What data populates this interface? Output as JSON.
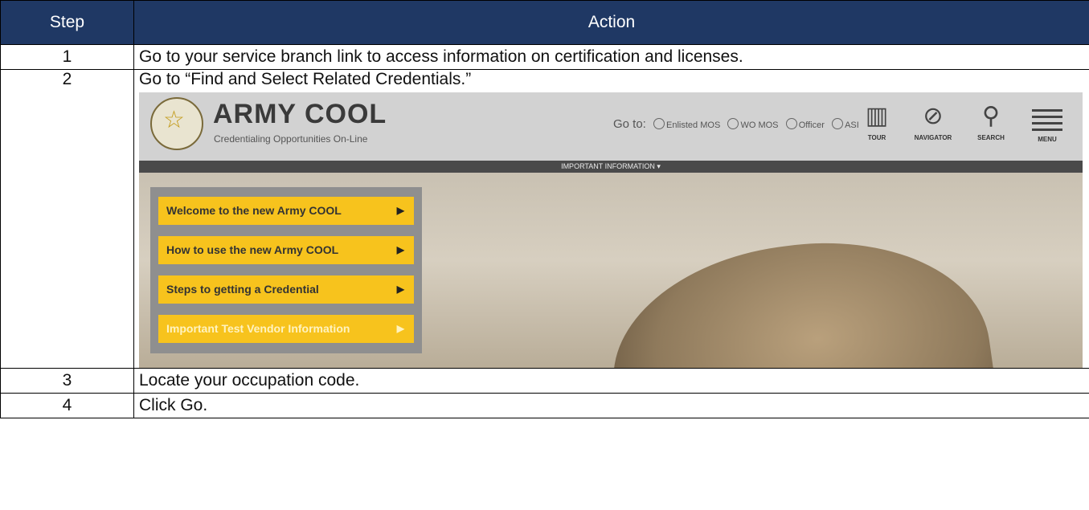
{
  "table": {
    "headers": [
      "Step",
      "Action"
    ],
    "rows": [
      {
        "step": "1",
        "action": "Go to your service branch link to access information on certification and licenses."
      },
      {
        "step": "2",
        "action": "Go to “Find and Select Related Credentials.”"
      },
      {
        "step": "3",
        "action": "Locate your occupation code."
      },
      {
        "step": "4",
        "action": "Click Go."
      }
    ]
  },
  "screenshot": {
    "brand": "ARMY COOL",
    "tagline": "Credentialing Opportunities On-Line",
    "goto_label": "Go to:",
    "goto_options": [
      "Enlisted MOS",
      "WO MOS",
      "Officer",
      "ASI"
    ],
    "nav": [
      "TOUR",
      "NAVIGATOR",
      "SEARCH",
      "MENU"
    ],
    "info_bar": "IMPORTANT INFORMATION ▾",
    "menu_items": [
      "Welcome to the new Army COOL",
      "How to use the new Army COOL",
      "Steps to getting a Credential",
      "Important Test Vendor Information"
    ],
    "colors": {
      "header_bg": "#1f3864",
      "menu_yellow": "#f7c31d"
    }
  }
}
